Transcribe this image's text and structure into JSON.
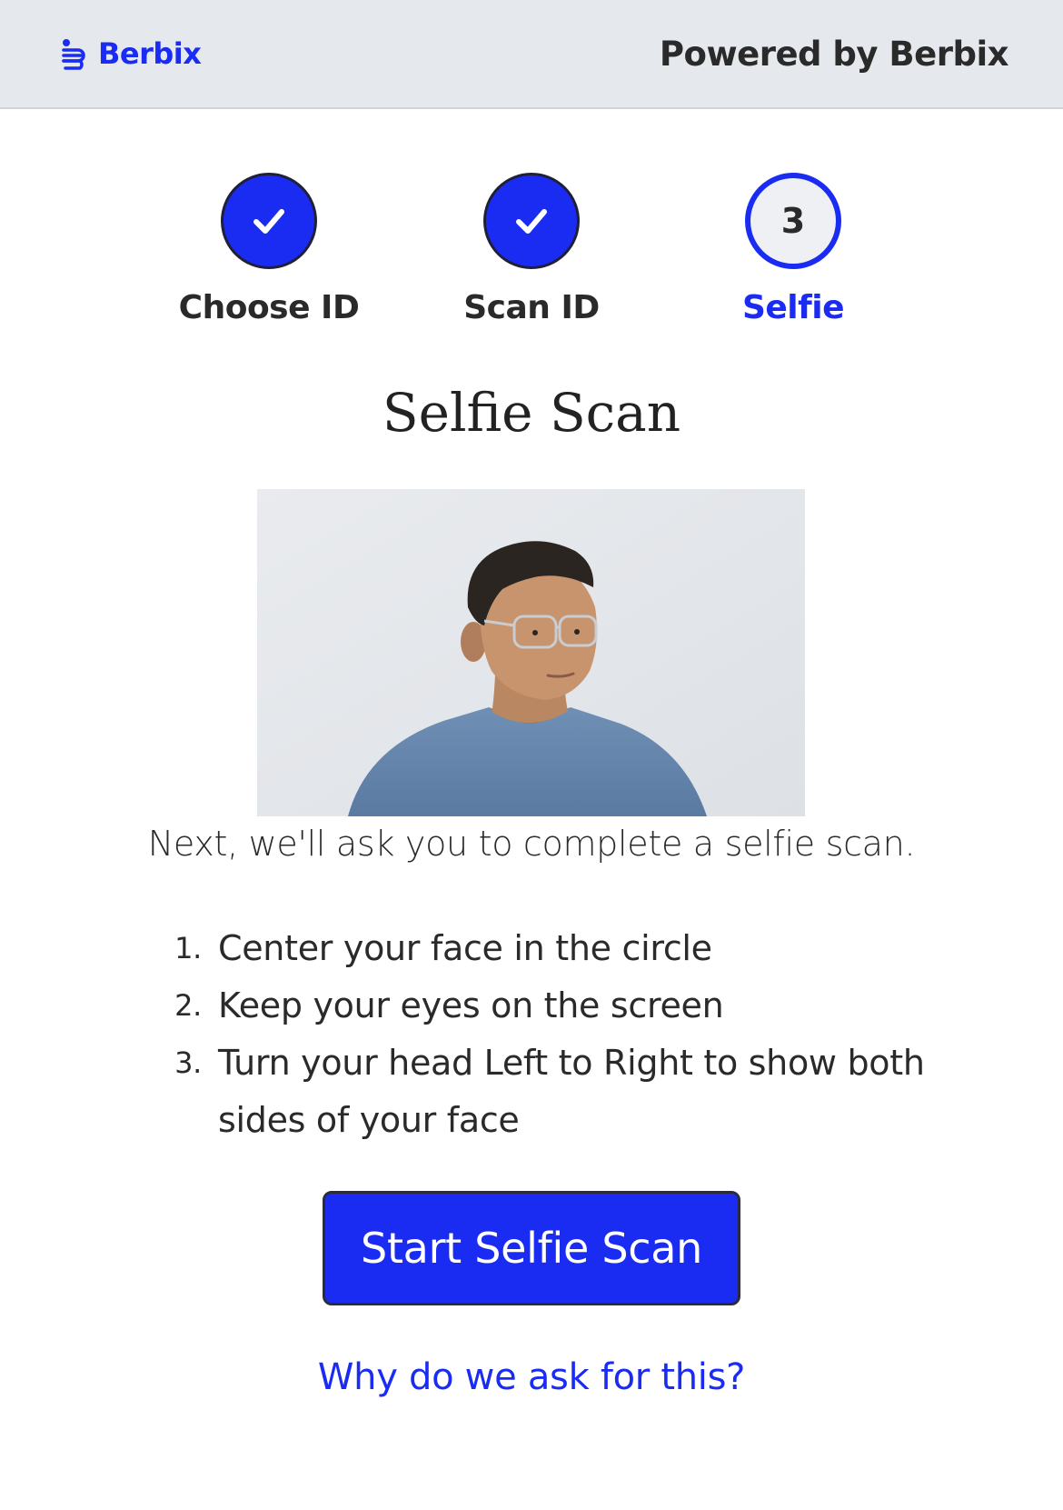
{
  "header": {
    "brand_name": "Berbix",
    "powered_by": "Powered by Berbix"
  },
  "stepper": {
    "steps": [
      {
        "label": "Choose ID",
        "state": "complete"
      },
      {
        "label": "Scan ID",
        "state": "complete"
      },
      {
        "label": "Selfie",
        "state": "current",
        "number": "3"
      }
    ]
  },
  "main": {
    "title": "Selfie Scan",
    "intro": "Next, we'll ask you to complete a selfie scan.",
    "instructions": [
      {
        "index": "1.",
        "text": "Center your face in the circle"
      },
      {
        "index": "2.",
        "text": "Keep your eyes on the screen"
      },
      {
        "index": "3.",
        "text": "Turn your head Left to Right to show both sides of your face"
      }
    ],
    "start_button": "Start Selfie Scan",
    "why_link": "Why do we ask for this?"
  },
  "colors": {
    "brand_blue": "#1b2cf2",
    "header_bg": "#e5e8ec",
    "text": "#2a2a2a"
  }
}
